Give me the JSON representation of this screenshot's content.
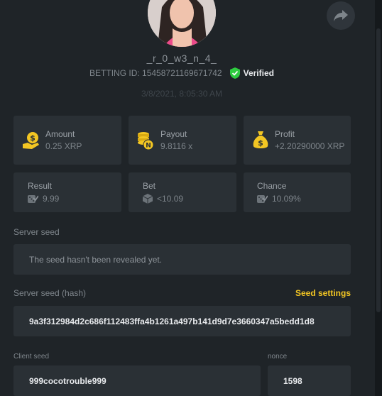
{
  "profile": {
    "username": "_r_0_w3_n_4_",
    "betting_id": "BETTING ID: 15458721169671742",
    "verified_label": "Verified",
    "date": "3/8/2021, 8:05:30 AM"
  },
  "stats": {
    "amount": {
      "label": "Amount",
      "value": "0.25 XRP"
    },
    "payout": {
      "label": "Payout",
      "value": "9.8116 x"
    },
    "profit": {
      "label": "Profit",
      "value": "+2.20290000 XRP"
    },
    "result": {
      "label": "Result",
      "value": "9.99"
    },
    "bet": {
      "label": "Bet",
      "value": "<10.09"
    },
    "chance": {
      "label": "Chance",
      "value": "10.09%"
    }
  },
  "server_seed": {
    "label": "Server seed",
    "value": "The seed hasn't been revealed yet."
  },
  "server_seed_hash": {
    "label": "Server seed (hash)",
    "settings_label": "Seed settings",
    "value": "9a3f312984d2c686f112483ffa4b1261a497b141d9d7e3660347a5bedd1d8"
  },
  "client_seed": {
    "label": "Client seed",
    "value": "999cocotrouble999"
  },
  "nonce": {
    "label": "nonce",
    "value": "1598"
  },
  "colors": {
    "background": "#1f2428",
    "card": "#2a3035",
    "accent_gold": "#f3c623",
    "verified_green": "#2ecc40"
  },
  "icons": [
    "avatar",
    "share-icon",
    "verified-check-icon",
    "money-hand-icon",
    "coin-stack-icon",
    "money-bag-icon",
    "dice-icon",
    "box-icon"
  ]
}
